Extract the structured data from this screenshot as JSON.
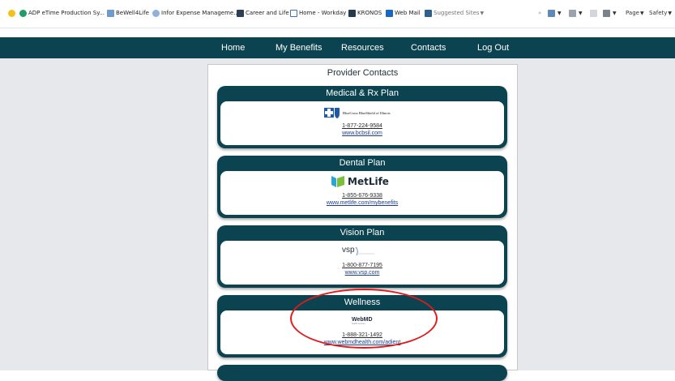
{
  "favorites": {
    "items": [
      {
        "label": "ADP eTime Production Sy..."
      },
      {
        "label": "BeWell4Life"
      },
      {
        "label": "Infor Expense Manageme..."
      },
      {
        "label": "Career and Life"
      },
      {
        "label": "Home - Workday"
      },
      {
        "label": "KRONOS"
      },
      {
        "label": "Web Mail"
      },
      {
        "label": "Suggested Sites"
      }
    ],
    "tools": {
      "page": "Page",
      "safety": "Safety"
    }
  },
  "nav": {
    "items": [
      {
        "label": "Home"
      },
      {
        "label": "My Benefits"
      },
      {
        "label": "Resources"
      },
      {
        "label": "Contacts"
      },
      {
        "label": "Log Out"
      }
    ]
  },
  "panel": {
    "title": "Provider Contacts",
    "cards": [
      {
        "title": "Medical & Rx Plan",
        "logo_text": "BlueCross BlueShield of Illinois",
        "phone": "1-877-224-9584",
        "url": "www.bcbsil.com"
      },
      {
        "title": "Dental Plan",
        "logo_text": "MetLife",
        "phone": "1-855-676-9338",
        "url": "www.metlife.com/mybenefits"
      },
      {
        "title": "Vision Plan",
        "logo_text": "vsp",
        "phone": "1-800-877-7195",
        "url": "www.vsp.com"
      },
      {
        "title": "Wellness",
        "logo_text": "WebMD",
        "logo_sub": "health services",
        "phone": "1-888-321-1492",
        "url": "www.webmdhealth.com/adient"
      }
    ]
  },
  "colors": {
    "nav_bg": "#0c4350",
    "card_bg": "#0c4350",
    "page_bg": "#e6e8ec",
    "highlight": "#e11b1b"
  }
}
